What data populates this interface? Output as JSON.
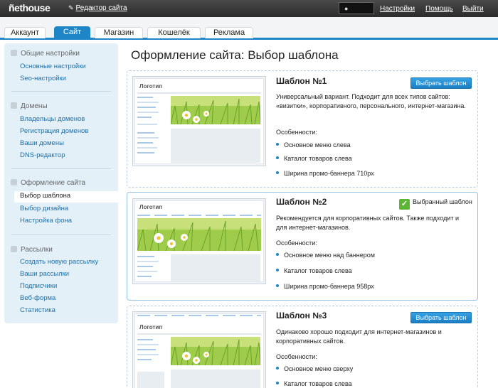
{
  "topbar": {
    "logo": "ñethouse",
    "editor_link": "Редактор сайта",
    "user_name": "",
    "links": [
      "Настройки",
      "Помощь",
      "Выйти"
    ]
  },
  "tabs": [
    {
      "label": "Аккаунт",
      "active": false
    },
    {
      "label": "Сайт",
      "active": true
    },
    {
      "label": "Магазин",
      "active": false
    },
    {
      "label": "Кошелёк",
      "active": false
    },
    {
      "label": "Реклама",
      "active": false
    }
  ],
  "sidebar": {
    "sections": [
      {
        "title": "Общие настройки",
        "items": [
          "Основные настройки",
          "Seo-настройки"
        ]
      },
      {
        "title": "Домены",
        "items": [
          "Владельцы доменов",
          "Регистрация доменов",
          "Ваши домены",
          "DNS-редактор"
        ]
      },
      {
        "title": "Оформление сайта",
        "items": [
          "Выбор шаблона",
          "Выбор дизайна",
          "Настройка фона"
        ],
        "active_item": "Выбор шаблона"
      },
      {
        "title": "Рассылки",
        "items": [
          "Создать новую рассылку",
          "Ваши рассылки",
          "Подписчики",
          "Веб-форма",
          "Статистика"
        ]
      }
    ]
  },
  "main": {
    "title": "Оформление сайта: Выбор шаблона",
    "templates": [
      {
        "title": "Шаблон №1",
        "button": "Выбрать шаблон",
        "description": "Универсальный вариант. Подходит для всех типов сайтов: «визитки», корпоративного, персонального, интернет-магазина.",
        "features_label": "Особенности:",
        "features": [
          "Основное меню слева",
          "Каталог товаров слева",
          "Ширина промо-баннера 710px"
        ],
        "thumb_logo": "Логотип"
      },
      {
        "title": "Шаблон №2",
        "selected_label": "Выбранный шаблон",
        "description": "Рекомендуется для корпоративных сайтов. Также подходит и для интернет-магазинов.",
        "features_label": "Особенности:",
        "features": [
          "Основное меню над баннером",
          "Каталог товаров слева",
          "Ширина промо-баннера 958px"
        ],
        "thumb_logo": "Логотип"
      },
      {
        "title": "Шаблон №3",
        "button": "Выбрать шаблон",
        "description": "Одинаково хорошо подходит для интернет-магазинов и корпоративных сайтов.",
        "features_label": "Особенности:",
        "features": [
          "Основное меню сверху",
          "Каталог товаров слева"
        ],
        "thumb_logo": "Логотип"
      }
    ]
  },
  "colors": {
    "accent": "#1e86c7",
    "topbar": "#2b2b2b",
    "sidebar_bg": "#e3f0f8",
    "link": "#1d6fa8",
    "selected_check": "#5cb535"
  },
  "icons": {
    "editor": "pencil-icon",
    "user": "user-icon",
    "check": "checkmark-icon"
  }
}
